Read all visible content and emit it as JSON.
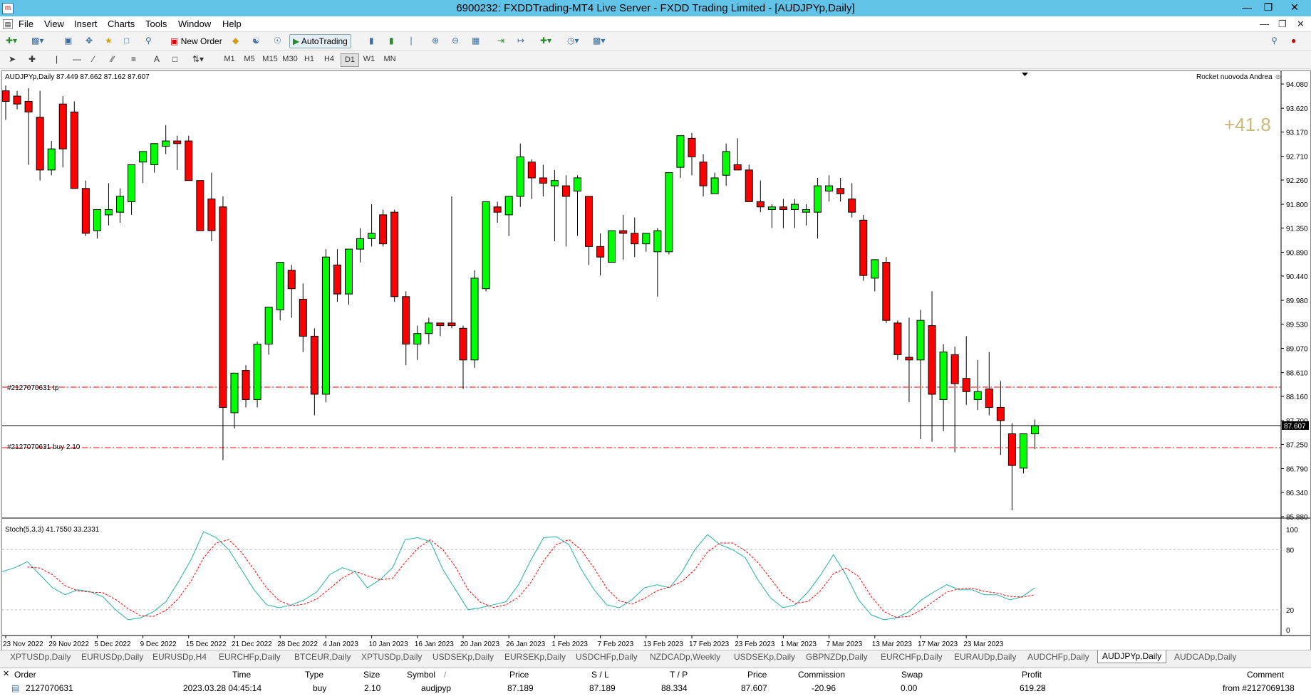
{
  "window": {
    "title": "6900232: FXDDTrading-MT4 Live Server - FXDD Trading Limited - [AUDJPYp,Daily]"
  },
  "menu": [
    "File",
    "View",
    "Insert",
    "Charts",
    "Tools",
    "Window",
    "Help"
  ],
  "toolbar": {
    "new_order": "New Order",
    "autotrading": "AutoTrading"
  },
  "timeframes": [
    "M1",
    "M5",
    "M15",
    "M30",
    "H1",
    "H4",
    "D1",
    "W1",
    "MN"
  ],
  "active_timeframe": "D1",
  "chart": {
    "header": "AUDJPYp,Daily  87.449 87.662 87.162 87.607",
    "ea_label": "Rocket nuovoda Andrea ☺",
    "profit_overlay": "+41.8",
    "tp_label": "#2127070631 tp",
    "buy_label": "#2127070631 buy 2.10",
    "current_price": "87.607",
    "indicator_label": "Stoch(5,3,3) 41.7550 33.2331",
    "price_ticks": [
      "94.080",
      "93.620",
      "93.170",
      "92.710",
      "92.260",
      "91.800",
      "91.350",
      "90.890",
      "90.440",
      "89.980",
      "89.530",
      "89.070",
      "88.610",
      "88.160",
      "87.700",
      "87.250",
      "86.790",
      "86.340",
      "85.880"
    ],
    "stoch_ticks": [
      "100",
      "80",
      "20",
      "0"
    ],
    "date_ticks": [
      "23 Nov 2022",
      "29 Nov 2022",
      "5 Dec 2022",
      "9 Dec 2022",
      "15 Dec 2022",
      "21 Dec 2022",
      "28 Dec 2022",
      "4 Jan 2023",
      "10 Jan 2023",
      "16 Jan 2023",
      "20 Jan 2023",
      "26 Jan 2023",
      "1 Feb 2023",
      "7 Feb 2023",
      "13 Feb 2023",
      "17 Feb 2023",
      "23 Feb 2023",
      "1 Mar 2023",
      "7 Mar 2023",
      "13 Mar 2023",
      "17 Mar 2023",
      "23 Mar 2023"
    ],
    "colors": {
      "bull": "#00ff00",
      "bear": "#ff0000",
      "stoch_main": "#20b2aa",
      "stoch_signal": "#ff0000",
      "order_line": "#ff0000",
      "profit_text": "#c8b97a"
    }
  },
  "chart_data": {
    "type": "candlestick",
    "symbol": "AUDJPYp",
    "timeframe": "Daily",
    "ylim": [
      85.88,
      94.08
    ],
    "tp_level": 88.334,
    "open_price": 87.189,
    "current_price": 87.607,
    "candles": [
      [
        93.95,
        94.05,
        93.4,
        93.75
      ],
      [
        93.85,
        93.95,
        93.6,
        93.7
      ],
      [
        93.75,
        94.0,
        92.55,
        93.55
      ],
      [
        93.45,
        93.95,
        92.25,
        92.45
      ],
      [
        92.45,
        93.0,
        92.35,
        92.85
      ],
      [
        93.7,
        93.85,
        92.5,
        92.85
      ],
      [
        93.55,
        93.75,
        92.35,
        92.1
      ],
      [
        92.1,
        92.25,
        91.2,
        91.25
      ],
      [
        91.3,
        91.65,
        91.15,
        91.7
      ],
      [
        91.6,
        92.2,
        91.4,
        91.7
      ],
      [
        91.65,
        92.1,
        91.45,
        91.95
      ],
      [
        91.85,
        92.3,
        91.6,
        92.55
      ],
      [
        92.6,
        92.75,
        92.2,
        92.8
      ],
      [
        92.55,
        92.9,
        92.4,
        92.95
      ],
      [
        92.9,
        93.3,
        92.75,
        93.0
      ],
      [
        93.0,
        93.1,
        92.45,
        92.95
      ],
      [
        93.0,
        93.1,
        92.25,
        92.25
      ],
      [
        92.25,
        92.25,
        91.35,
        91.3
      ],
      [
        91.9,
        92.4,
        91.1,
        91.3
      ],
      [
        91.75,
        91.95,
        86.95,
        87.95
      ],
      [
        87.85,
        88.6,
        87.55,
        88.6
      ],
      [
        88.65,
        88.75,
        87.95,
        88.1
      ],
      [
        88.1,
        89.2,
        87.95,
        89.15
      ],
      [
        89.15,
        89.8,
        88.95,
        89.85
      ],
      [
        89.8,
        90.65,
        89.6,
        90.7
      ],
      [
        90.55,
        90.65,
        89.65,
        90.2
      ],
      [
        90.0,
        90.3,
        89.0,
        89.3
      ],
      [
        89.3,
        89.45,
        87.8,
        88.2
      ],
      [
        88.2,
        90.95,
        88.05,
        90.8
      ],
      [
        90.65,
        90.95,
        89.95,
        90.1
      ],
      [
        90.1,
        90.95,
        89.9,
        90.95
      ],
      [
        90.95,
        91.35,
        90.7,
        91.15
      ],
      [
        91.15,
        91.8,
        91.0,
        91.25
      ],
      [
        91.6,
        91.7,
        91.0,
        91.05
      ],
      [
        91.65,
        91.7,
        89.95,
        90.05
      ],
      [
        90.05,
        90.15,
        88.75,
        89.15
      ],
      [
        89.15,
        89.5,
        88.85,
        89.35
      ],
      [
        89.35,
        89.65,
        89.15,
        89.55
      ],
      [
        89.55,
        89.55,
        89.3,
        89.5
      ],
      [
        89.55,
        91.95,
        89.45,
        89.5
      ],
      [
        89.45,
        89.5,
        88.3,
        88.85
      ],
      [
        88.85,
        90.55,
        88.7,
        90.4
      ],
      [
        90.2,
        91.85,
        90.15,
        91.85
      ],
      [
        91.75,
        91.85,
        91.45,
        91.65
      ],
      [
        91.6,
        91.75,
        91.2,
        91.95
      ],
      [
        91.95,
        92.95,
        91.75,
        92.7
      ],
      [
        92.6,
        92.65,
        91.9,
        92.3
      ],
      [
        92.3,
        92.55,
        91.95,
        92.2
      ],
      [
        92.15,
        92.45,
        91.1,
        92.25
      ],
      [
        92.15,
        92.35,
        91.0,
        91.95
      ],
      [
        92.05,
        92.35,
        91.2,
        92.3
      ],
      [
        91.95,
        91.95,
        90.65,
        91.0
      ],
      [
        91.0,
        91.25,
        90.45,
        90.8
      ],
      [
        90.7,
        91.15,
        90.85,
        91.3
      ],
      [
        91.3,
        91.6,
        90.75,
        91.25
      ],
      [
        91.25,
        91.55,
        90.8,
        91.05
      ],
      [
        91.05,
        91.25,
        90.9,
        91.25
      ],
      [
        90.9,
        91.35,
        90.05,
        91.3
      ],
      [
        90.9,
        92.3,
        90.85,
        92.4
      ],
      [
        92.5,
        93.1,
        92.3,
        93.1
      ],
      [
        93.05,
        93.15,
        92.35,
        92.7
      ],
      [
        92.6,
        92.75,
        91.95,
        92.15
      ],
      [
        92.0,
        92.4,
        92.05,
        92.3
      ],
      [
        92.35,
        92.95,
        92.15,
        92.8
      ],
      [
        92.55,
        93.05,
        92.5,
        92.45
      ],
      [
        92.45,
        92.55,
        91.9,
        91.85
      ],
      [
        91.85,
        92.25,
        91.65,
        91.75
      ],
      [
        91.7,
        91.8,
        91.35,
        91.75
      ],
      [
        91.75,
        91.9,
        91.35,
        91.7
      ],
      [
        91.7,
        91.9,
        91.35,
        91.8
      ],
      [
        91.65,
        91.8,
        91.4,
        91.7
      ],
      [
        91.65,
        92.3,
        91.15,
        92.15
      ],
      [
        92.05,
        92.35,
        91.85,
        92.15
      ],
      [
        92.1,
        92.3,
        91.85,
        92.0
      ],
      [
        91.9,
        92.2,
        91.55,
        91.65
      ],
      [
        91.5,
        91.6,
        90.35,
        90.45
      ],
      [
        90.4,
        90.5,
        90.15,
        90.75
      ],
      [
        90.7,
        90.8,
        89.55,
        89.6
      ],
      [
        89.55,
        89.6,
        88.85,
        88.95
      ],
      [
        88.9,
        89.65,
        88.05,
        88.85
      ],
      [
        88.85,
        89.8,
        87.35,
        89.6
      ],
      [
        89.5,
        90.15,
        87.3,
        88.2
      ],
      [
        88.1,
        89.15,
        87.5,
        89.0
      ],
      [
        88.95,
        89.1,
        87.1,
        88.4
      ],
      [
        88.5,
        89.3,
        88.0,
        88.25
      ],
      [
        88.1,
        88.85,
        87.9,
        88.25
      ],
      [
        88.3,
        89.0,
        87.8,
        87.95
      ],
      [
        87.95,
        88.45,
        87.05,
        87.7
      ],
      [
        87.45,
        87.65,
        86.0,
        86.85
      ],
      [
        86.8,
        87.45,
        86.7,
        87.45
      ],
      [
        87.45,
        87.72,
        87.16,
        87.6
      ]
    ],
    "stochastic": {
      "params": "5,3,3",
      "main_last": 41.755,
      "signal_last": 33.2331,
      "main": [
        58,
        62,
        68,
        55,
        42,
        35,
        40,
        38,
        33,
        20,
        10,
        12,
        18,
        28,
        48,
        70,
        98,
        92,
        80,
        60,
        40,
        25,
        22,
        25,
        30,
        38,
        55,
        62,
        58,
        42,
        50,
        62,
        90,
        92,
        88,
        60,
        40,
        20,
        22,
        25,
        28,
        45,
        70,
        92,
        93,
        85,
        60,
        40,
        25,
        22,
        30,
        42,
        45,
        42,
        58,
        80,
        95,
        85,
        80,
        72,
        50,
        32,
        22,
        25,
        38,
        55,
        75,
        55,
        30,
        15,
        10,
        12,
        18,
        30,
        38,
        45,
        40,
        40,
        35,
        35,
        30,
        33,
        42
      ]
    },
    "xlabel": "",
    "ylabel": ""
  },
  "tabs": [
    "XPTUSDp,Daily",
    "EURUSDp,Daily",
    "EURUSDp,H4",
    "EURCHFp,Daily",
    "BTCEUR,Daily",
    "XPTUSDp,Daily",
    "USDSEKp,Daily",
    "EURSEKp,Daily",
    "USDCHFp,Daily",
    "NZDCADp,Weekly",
    "USDSEKp,Daily",
    "GBPNZDp,Daily",
    "EURCHFp,Daily",
    "EURAUDp,Daily",
    "AUDCHFp,Daily",
    "AUDJPYp,Daily",
    "AUDCADp,Daily"
  ],
  "active_tab": "AUDJPYp,Daily",
  "terminal": {
    "headers": {
      "order": "Order",
      "time": "Time",
      "type": "Type",
      "size": "Size",
      "symbol": "Symbol",
      "price": "Price",
      "sl": "S / L",
      "tp": "T / P",
      "price2": "Price",
      "commission": "Commission",
      "swap": "Swap",
      "profit": "Profit",
      "comment": "Comment"
    },
    "row": {
      "order": "2127070631",
      "time": "2023.03.28 04:45:14",
      "type": "buy",
      "size": "2.10",
      "symbol": "audjpyp",
      "price": "87.189",
      "sl": "87.189",
      "tp": "88.334",
      "price2": "87.607",
      "commission": "-20.96",
      "swap": "0.00",
      "profit": "619.28",
      "comment": "from #2127069138"
    }
  }
}
